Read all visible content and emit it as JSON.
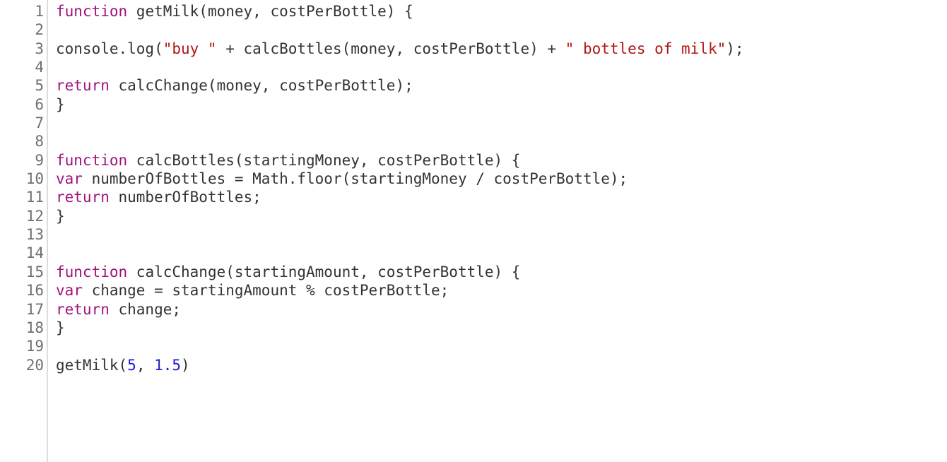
{
  "editor": {
    "line_numbers": [
      "1",
      "2",
      "3",
      "4",
      "5",
      "6",
      "7",
      "8",
      "9",
      "10",
      "11",
      "12",
      "13",
      "14",
      "15",
      "16",
      "17",
      "18",
      "19",
      "20"
    ],
    "lines": [
      {
        "tokens": [
          {
            "t": "kw",
            "v": "function"
          },
          {
            "t": "plain",
            "v": " getMilk(money, costPerBottle) {"
          }
        ]
      },
      {
        "tokens": []
      },
      {
        "tokens": [
          {
            "t": "plain",
            "v": "console.log("
          },
          {
            "t": "str",
            "v": "\"buy \""
          },
          {
            "t": "plain",
            "v": " + calcBottles(money, costPerBottle) + "
          },
          {
            "t": "str",
            "v": "\" bottles of milk\""
          },
          {
            "t": "plain",
            "v": ");"
          }
        ]
      },
      {
        "tokens": []
      },
      {
        "tokens": [
          {
            "t": "kw",
            "v": "return"
          },
          {
            "t": "plain",
            "v": " calcChange(money, costPerBottle);"
          }
        ]
      },
      {
        "tokens": [
          {
            "t": "plain",
            "v": "}"
          }
        ]
      },
      {
        "tokens": []
      },
      {
        "tokens": []
      },
      {
        "tokens": [
          {
            "t": "kw",
            "v": "function"
          },
          {
            "t": "plain",
            "v": " calcBottles(startingMoney, costPerBottle) {"
          }
        ]
      },
      {
        "tokens": [
          {
            "t": "kw",
            "v": "var"
          },
          {
            "t": "plain",
            "v": " numberOfBottles = Math.floor(startingMoney / costPerBottle);"
          }
        ]
      },
      {
        "tokens": [
          {
            "t": "kw",
            "v": "return"
          },
          {
            "t": "plain",
            "v": " numberOfBottles;"
          }
        ]
      },
      {
        "tokens": [
          {
            "t": "plain",
            "v": "}"
          }
        ]
      },
      {
        "tokens": []
      },
      {
        "tokens": []
      },
      {
        "tokens": [
          {
            "t": "kw",
            "v": "function"
          },
          {
            "t": "plain",
            "v": " calcChange(startingAmount, costPerBottle) {"
          }
        ]
      },
      {
        "tokens": [
          {
            "t": "kw",
            "v": "var"
          },
          {
            "t": "plain",
            "v": " change = startingAmount % costPerBottle;"
          }
        ]
      },
      {
        "tokens": [
          {
            "t": "kw",
            "v": "return"
          },
          {
            "t": "plain",
            "v": " change;"
          }
        ]
      },
      {
        "tokens": [
          {
            "t": "plain",
            "v": "}"
          }
        ]
      },
      {
        "tokens": []
      },
      {
        "tokens": [
          {
            "t": "plain",
            "v": "getMilk("
          },
          {
            "t": "num",
            "v": "5"
          },
          {
            "t": "plain",
            "v": ", "
          },
          {
            "t": "num",
            "v": "1.5"
          },
          {
            "t": "plain",
            "v": ")"
          }
        ]
      }
    ]
  },
  "colors": {
    "keyword": "#a0137d",
    "string": "#b01515",
    "number": "#1a1ad4",
    "text": "#333333",
    "line_number": "#6f6f6f",
    "gutter_border": "#dddddd"
  }
}
